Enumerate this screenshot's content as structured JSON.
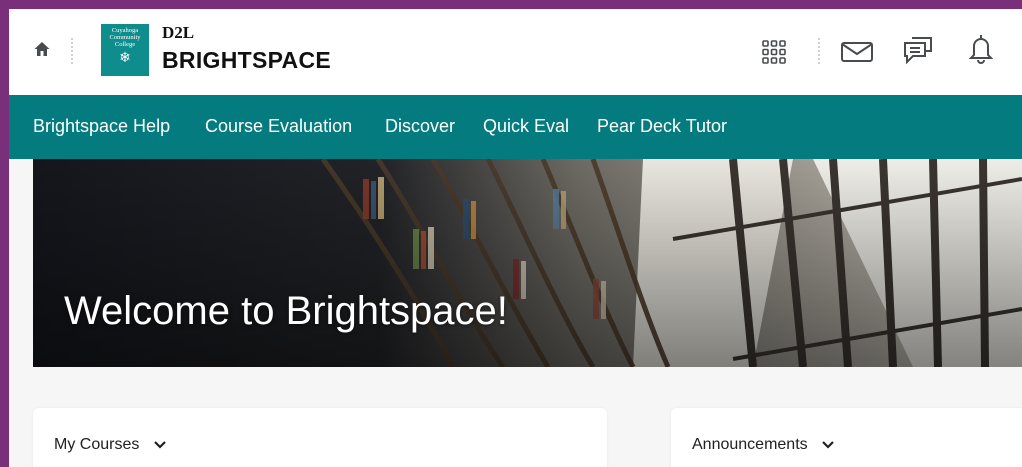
{
  "header": {
    "home_icon": "home-icon",
    "institution_logo_text": "Cuyahoga Community College",
    "brand_top": "D2L",
    "brand_name": "BRIGHTSPACE",
    "icons": [
      "waffle-grid-icon",
      "mail-icon",
      "chat-icon",
      "bell-icon"
    ]
  },
  "navbar": {
    "items": [
      {
        "label": "Brightspace Help"
      },
      {
        "label": "Course Evaluation"
      },
      {
        "label": "Discover"
      },
      {
        "label": "Quick Eval"
      },
      {
        "label": "Pear Deck Tutor"
      }
    ]
  },
  "hero": {
    "title": "Welcome to Brightspace!"
  },
  "widgets": {
    "my_courses": {
      "title": "My Courses"
    },
    "announcements": {
      "title": "Announcements"
    }
  },
  "colors": {
    "outer_frame": "#7a2f7a",
    "navbar_bg": "#047c7f",
    "logo_tile": "#0f8c8c",
    "brand_accent": "#e87511"
  }
}
